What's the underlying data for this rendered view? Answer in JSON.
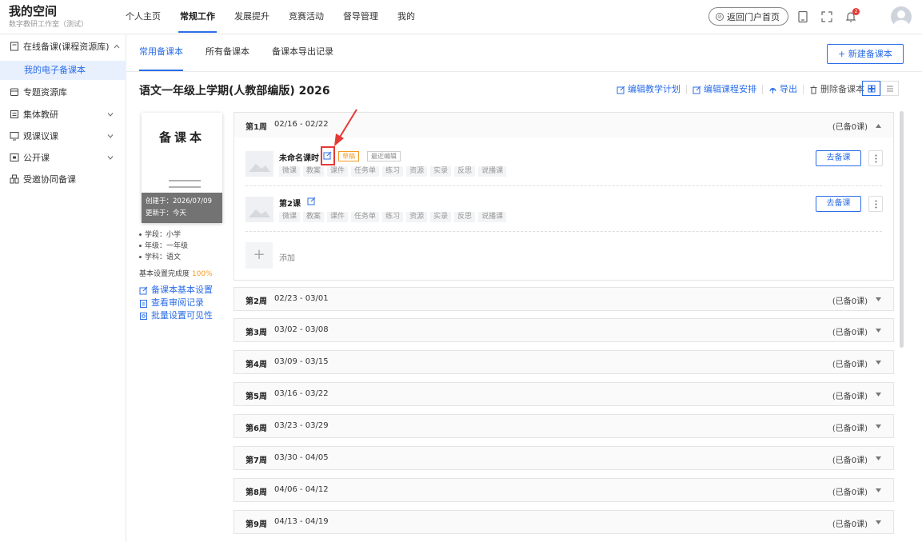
{
  "brand": {
    "title": "我的空间",
    "subtitle": "数字教研工作室（测试）"
  },
  "topnav": [
    {
      "label": "个人主页"
    },
    {
      "label": "常规工作",
      "active": true
    },
    {
      "label": "发展提升"
    },
    {
      "label": "竞赛活动"
    },
    {
      "label": "督导管理"
    },
    {
      "label": "我的"
    }
  ],
  "header": {
    "back_portal": "返回门户首页",
    "notification_count": "2"
  },
  "sidebar": {
    "items": [
      {
        "label": "在线备课(课程资源库)",
        "icon": "document-icon",
        "expanded": true
      },
      {
        "label": "专题资源库",
        "icon": "folder-icon"
      },
      {
        "label": "集体教研",
        "icon": "list-icon"
      },
      {
        "label": "观课议课",
        "icon": "screen-icon"
      },
      {
        "label": "公开课",
        "icon": "video-icon"
      },
      {
        "label": "受邀协同备课",
        "icon": "group-icon"
      }
    ],
    "sub_active": "我的电子备课本"
  },
  "main": {
    "tabs": [
      "常用备课本",
      "所有备课本",
      "备课本导出记录"
    ],
    "new_button": "+ 新建备课本",
    "title": "语文一年级上学期(人教部编版) 2026",
    "actions": [
      "编辑教学计划",
      "编辑课程安排",
      "导出",
      "删除备课本"
    ]
  },
  "book": {
    "cover_title": "备课本",
    "created": "创建于：2026/07/09",
    "updated": "更新于：今天",
    "info": [
      "学段：小学",
      "年级：一年级",
      "学科：语文"
    ],
    "completion_label": "基本设置完成度",
    "completion_pct": "100%",
    "links": [
      "备课本基本设置",
      "查看审阅记录",
      "批量设置可见性"
    ]
  },
  "weeks": [
    {
      "label": "第1周",
      "dates": "02/16 - 02/22",
      "count": "(已备0课)"
    },
    {
      "label": "第2周",
      "dates": "02/23 - 03/01",
      "count": "(已备0课)"
    },
    {
      "label": "第3周",
      "dates": "03/02 - 03/08",
      "count": "(已备0课)"
    },
    {
      "label": "第4周",
      "dates": "03/09 - 03/15",
      "count": "(已备0课)"
    },
    {
      "label": "第5周",
      "dates": "03/16 - 03/22",
      "count": "(已备0课)"
    },
    {
      "label": "第6周",
      "dates": "03/23 - 03/29",
      "count": "(已备0课)"
    },
    {
      "label": "第7周",
      "dates": "03/30 - 04/05",
      "count": "(已备0课)"
    },
    {
      "label": "第8周",
      "dates": "04/06 - 04/12",
      "count": "(已备0课)"
    },
    {
      "label": "第9周",
      "dates": "04/13 - 04/19",
      "count": "(已备0课)"
    }
  ],
  "lessons": [
    {
      "name": "未命名课时",
      "badge_draft": "草稿",
      "badge_recent": "最近编辑",
      "go": "去备课"
    },
    {
      "name": "第2课",
      "go": "去备课"
    }
  ],
  "lesson_tags": [
    "微课",
    "教案",
    "课件",
    "任务单",
    "练习",
    "资源",
    "实录",
    "反思",
    "说播课"
  ],
  "add_label": "添加",
  "colors": {
    "accent": "#2b6de8",
    "draft": "#f59a23",
    "highlight": "#e53935"
  }
}
